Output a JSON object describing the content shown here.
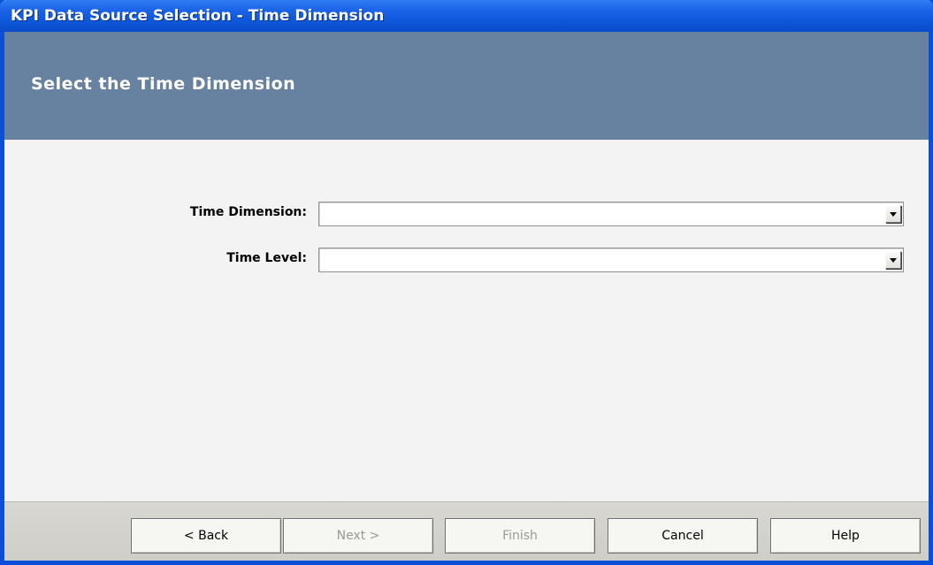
{
  "window": {
    "title": "KPI Data Source Selection - Time Dimension"
  },
  "header": {
    "title": "Select the Time Dimension"
  },
  "form": {
    "time_dimension": {
      "label": "Time Dimension:",
      "value": ""
    },
    "time_level": {
      "label": "Time Level:",
      "value": ""
    }
  },
  "footer": {
    "back_label": "< Back",
    "next_label": "Next >",
    "finish_label": "Finish",
    "cancel_label": "Cancel",
    "help_label": "Help"
  },
  "colors": {
    "titlebar": "#0a4fd8",
    "header_band": "#6682a0",
    "content_bg": "#f3f3f3",
    "footer_bg": "#d4d3cd"
  }
}
